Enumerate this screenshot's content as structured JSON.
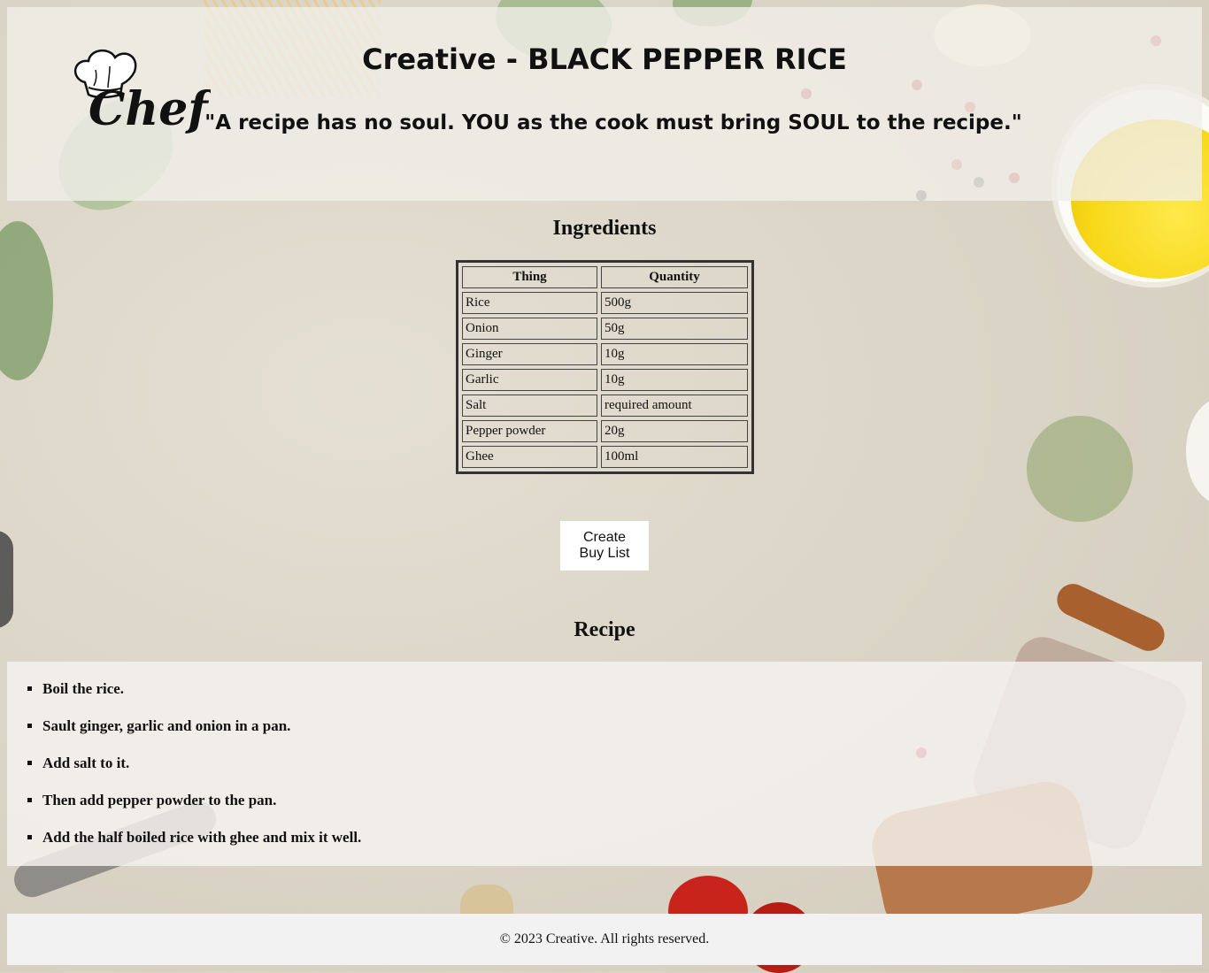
{
  "header": {
    "title": "Creative - BLACK PEPPER RICE",
    "quote": "\"A recipe has no soul. YOU as the cook must bring SOUL to the recipe.\"",
    "logo_text": "Chef"
  },
  "ingredients": {
    "heading": "Ingredients",
    "columns": [
      "Thing",
      "Quantity"
    ],
    "rows": [
      {
        "thing": "Rice",
        "quantity": "500g"
      },
      {
        "thing": "Onion",
        "quantity": "50g"
      },
      {
        "thing": "Ginger",
        "quantity": "10g"
      },
      {
        "thing": "Garlic",
        "quantity": "10g"
      },
      {
        "thing": "Salt",
        "quantity": "required amount"
      },
      {
        "thing": "Pepper powder",
        "quantity": "20g"
      },
      {
        "thing": "Ghee",
        "quantity": "100ml"
      }
    ]
  },
  "buy_button": {
    "label": "Create Buy List"
  },
  "recipe": {
    "heading": "Recipe",
    "steps": [
      "Boil the rice.",
      "Sault ginger, garlic and onion in a pan.",
      "Add salt to it.",
      "Then add pepper powder to the pan.",
      "Add the half boiled rice with ghee and mix it well."
    ]
  },
  "footer": {
    "text": "© 2023 Creative. All rights reserved."
  }
}
